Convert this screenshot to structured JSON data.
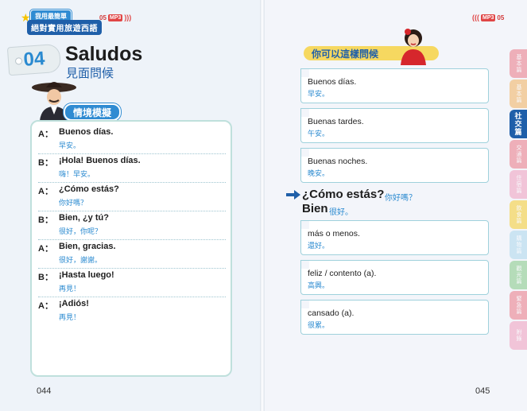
{
  "header": {
    "series_top": "我用最簡單",
    "series_bottom": "絕對實用旅遊西語",
    "track_left": "05",
    "track_right": "05",
    "mp3_label": "MP3"
  },
  "lesson": {
    "number": "04",
    "title": "Saludos",
    "subtitle": "見面問候"
  },
  "left": {
    "section_label": "情境模擬",
    "dialogue": [
      {
        "speaker": "A：",
        "es": "Buenos días.",
        "zh": "早安。"
      },
      {
        "speaker": "B：",
        "es": "¡Hola!  Buenos días.",
        "zh": "嗨！早安。"
      },
      {
        "speaker": "A：",
        "es": "¿Cómo estás?",
        "zh": "你好嗎？"
      },
      {
        "speaker": "B：",
        "es": "Bien, ¿y tú?",
        "zh": "很好，你呢？"
      },
      {
        "speaker": "A：",
        "es": "Bien, gracias.",
        "zh": "很好，謝謝。"
      },
      {
        "speaker": "B：",
        "es": "¡Hasta luego!",
        "zh": "再見！"
      },
      {
        "speaker": "A：",
        "es": "¡Adiós!",
        "zh": "再見！"
      }
    ],
    "page_number": "044"
  },
  "right": {
    "section_label": "你可以這樣問候",
    "greetings": [
      {
        "es": "Buenos días.",
        "zh": "早安。"
      },
      {
        "es": "Buenas tardes.",
        "zh": "午安。"
      },
      {
        "es": "Buenas noches.",
        "zh": "晚安。"
      }
    ],
    "question_es": "¿Cómo estás?",
    "question_zh": "你好嗎？",
    "answer_es": "Bien",
    "answer_zh": "很好。",
    "responses": [
      {
        "es": "más o menos.",
        "zh": "還好。"
      },
      {
        "es": "feliz / contento (a).",
        "zh": "高興。"
      },
      {
        "es": "cansado (a).",
        "zh": "很累。"
      }
    ],
    "page_number": "045"
  },
  "side_tabs": [
    {
      "label": "基本篇",
      "color": "#e95b6b"
    },
    {
      "label": "基本篇",
      "color": "#f2a23c"
    },
    {
      "label": "社交篇",
      "color": "#1f5fa9",
      "active": true
    },
    {
      "label": "交通篇",
      "color": "#e95b6b"
    },
    {
      "label": "住宿篇",
      "color": "#f08ab0"
    },
    {
      "label": "飲食篇",
      "color": "#f6c400"
    },
    {
      "label": "購物篇",
      "color": "#9bd0ea"
    },
    {
      "label": "觀光篇",
      "color": "#6cc06c"
    },
    {
      "label": "緊急篇",
      "color": "#e95b6b"
    },
    {
      "label": "附錄",
      "color": "#f08ab0"
    }
  ]
}
